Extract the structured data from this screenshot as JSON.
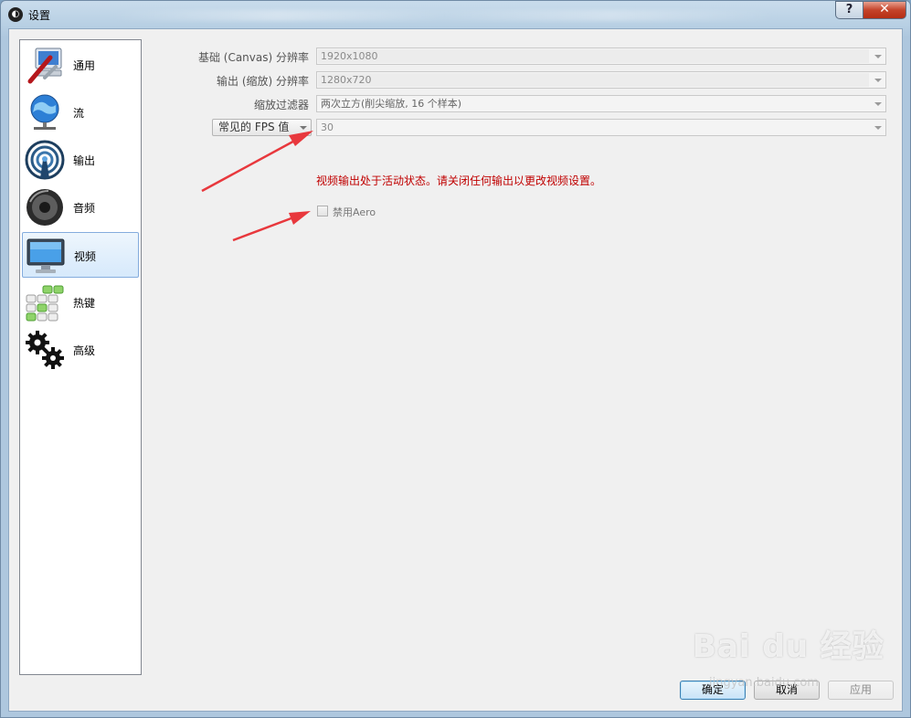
{
  "window": {
    "title": "设置",
    "help_label": "?",
    "close_label": "✕"
  },
  "sidebar": {
    "items": [
      {
        "label": "通用",
        "icon": "general-settings-icon"
      },
      {
        "label": "流",
        "icon": "stream-globe-icon"
      },
      {
        "label": "输出",
        "icon": "output-broadcast-icon"
      },
      {
        "label": "音频",
        "icon": "audio-speaker-icon"
      },
      {
        "label": "视频",
        "icon": "video-monitor-icon",
        "selected": true
      },
      {
        "label": "热键",
        "icon": "hotkeys-keyboard-icon"
      },
      {
        "label": "高级",
        "icon": "advanced-gears-icon"
      }
    ]
  },
  "video": {
    "base_resolution_label": "基础 (Canvas) 分辨率",
    "base_resolution_value": "1920x1080",
    "output_resolution_label": "输出 (缩放) 分辨率",
    "output_resolution_value": "1280x720",
    "downscale_filter_label": "缩放过滤器",
    "downscale_filter_value": "两次立方(削尖缩放, 16 个样本)",
    "fps_type_value": "常见的 FPS 值",
    "fps_value": "30",
    "warning_text": "视频输出处于活动状态。请关闭任何输出以更改视频设置。",
    "disable_aero_label": "禁用Aero",
    "disable_aero_checked": false
  },
  "buttons": {
    "ok": "确定",
    "cancel": "取消",
    "apply": "应用"
  },
  "watermark": {
    "text": "Bai du 经验",
    "url": "jingyan.baidu.com"
  },
  "colors": {
    "warning": "#c00000",
    "annotation_arrow": "#e8383d",
    "selection": "#d6e9fb"
  }
}
